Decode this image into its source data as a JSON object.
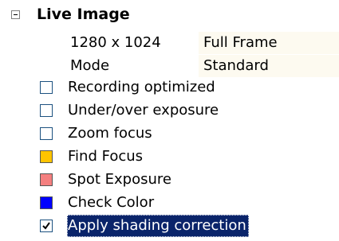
{
  "group": {
    "title": "Live Image",
    "expander_icon": "minus-box-icon"
  },
  "properties": [
    {
      "name": "1280 x 1024",
      "value": "Full Frame"
    },
    {
      "name": "Mode",
      "value": "Standard"
    }
  ],
  "options": [
    {
      "label": "Recording optimized",
      "kind": "checkbox",
      "checked": false,
      "color": null
    },
    {
      "label": "Under/over exposure",
      "kind": "checkbox",
      "checked": false,
      "color": null
    },
    {
      "label": "Zoom focus",
      "kind": "checkbox",
      "checked": false,
      "color": null
    },
    {
      "label": "Find Focus",
      "kind": "swatch",
      "checked": false,
      "color": "#ffc400"
    },
    {
      "label": "Spot Exposure",
      "kind": "swatch",
      "checked": false,
      "color": "#f47f7f"
    },
    {
      "label": "Check Color",
      "kind": "swatch",
      "checked": false,
      "color": "#0000ff"
    },
    {
      "label": "Apply shading correction",
      "kind": "checkbox",
      "checked": true,
      "color": null,
      "selected": true
    }
  ],
  "colors": {
    "selection_bg": "#0a246a",
    "value_bg": "#fdfaf0",
    "checkbox_border": "#1c5180"
  }
}
